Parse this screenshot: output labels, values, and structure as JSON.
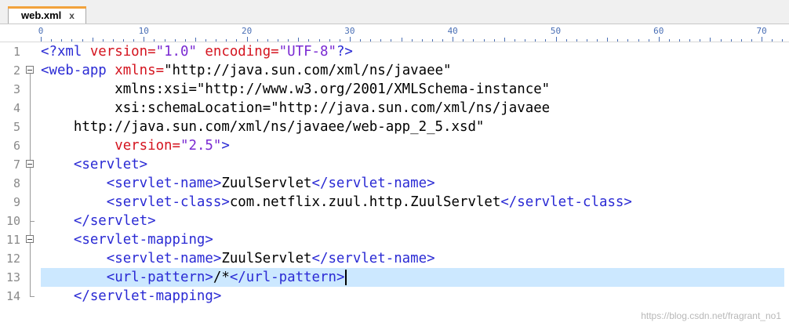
{
  "tab": {
    "label": "web.xml",
    "close": "x"
  },
  "ruler": {
    "labels": [
      "0",
      "10",
      "20",
      "30",
      "40",
      "50",
      "60",
      "70"
    ]
  },
  "lines": [
    {
      "n": "1",
      "parts": [
        [
          "pi",
          "<?xml "
        ],
        [
          "attr",
          "version="
        ],
        [
          "val",
          "\"1.0\""
        ],
        [
          "attr",
          " encoding="
        ],
        [
          "val",
          "\"UTF-8\""
        ],
        [
          "pi",
          "?>"
        ]
      ]
    },
    {
      "n": "2",
      "parts": [
        [
          "tag",
          "<web-app "
        ],
        [
          "attr",
          "xmlns="
        ],
        [
          "txt",
          "\"http://java.sun.com/xml/ns/javaee\""
        ]
      ]
    },
    {
      "n": "3",
      "parts": [
        [
          "txt",
          "         xmlns:xsi=\"http://www.w3.org/2001/XMLSchema-instance\""
        ]
      ]
    },
    {
      "n": "4",
      "parts": [
        [
          "txt",
          "         xsi:schemaLocation=\"http://java.sun.com/xml/ns/javaee"
        ]
      ]
    },
    {
      "n": "5",
      "parts": [
        [
          "txt",
          "    http://java.sun.com/xml/ns/javaee/web-app_2_5.xsd\""
        ]
      ]
    },
    {
      "n": "6",
      "parts": [
        [
          "attr",
          "         version="
        ],
        [
          "val",
          "\"2.5\""
        ],
        [
          "tag",
          ">"
        ]
      ]
    },
    {
      "n": "7",
      "parts": [
        [
          "tag",
          "    <servlet>"
        ]
      ]
    },
    {
      "n": "8",
      "parts": [
        [
          "tag",
          "        <servlet-name>"
        ],
        [
          "txt",
          "ZuulServlet"
        ],
        [
          "tag",
          "</servlet-name>"
        ]
      ]
    },
    {
      "n": "9",
      "parts": [
        [
          "tag",
          "        <servlet-class>"
        ],
        [
          "txt",
          "com.netflix.zuul.http.ZuulServlet"
        ],
        [
          "tag",
          "</servlet-class>"
        ]
      ]
    },
    {
      "n": "10",
      "parts": [
        [
          "tag",
          "    </servlet>"
        ]
      ]
    },
    {
      "n": "11",
      "parts": [
        [
          "tag",
          "    <servlet-mapping>"
        ]
      ]
    },
    {
      "n": "12",
      "parts": [
        [
          "tag",
          "        <servlet-name>"
        ],
        [
          "txt",
          "ZuulServlet"
        ],
        [
          "tag",
          "</servlet-name>"
        ]
      ]
    },
    {
      "n": "13",
      "parts": [
        [
          "tag",
          "        <url-pattern>"
        ],
        [
          "txt",
          "/*"
        ],
        [
          "tag",
          "</url-pattern>"
        ]
      ]
    },
    {
      "n": "14",
      "parts": [
        [
          "tag",
          "    </servlet-mapping>"
        ]
      ]
    }
  ],
  "active_line": "13",
  "watermark": "https://blog.csdn.net/fragrant_no1",
  "colors": {
    "tag": "#2a2ad4",
    "attr": "#d4141f",
    "value": "#7a2ad2",
    "highlight": "#cce8ff",
    "tab_accent": "#f2a23c"
  }
}
